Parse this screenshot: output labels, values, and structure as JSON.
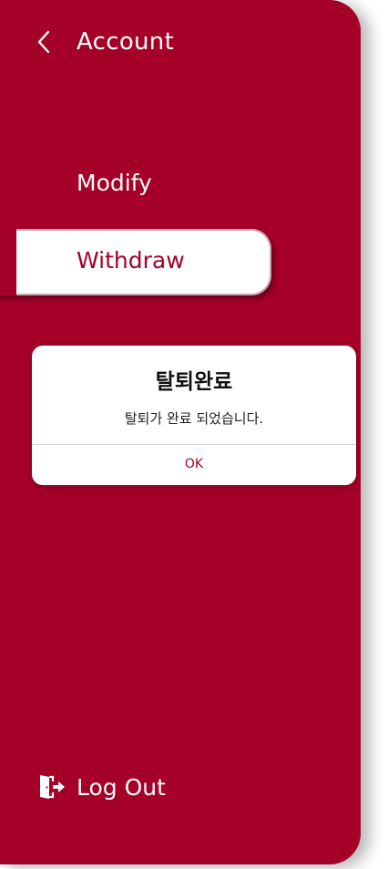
{
  "header": {
    "title": "Account",
    "back_icon": "chevron-left-icon"
  },
  "menu": {
    "items": [
      {
        "label": "Modify",
        "active": false
      },
      {
        "label": "Withdraw",
        "active": true
      }
    ]
  },
  "dialog": {
    "title": "탈퇴완료",
    "message": "탈퇴가 완료 되었습니다.",
    "ok_label": "OK"
  },
  "footer": {
    "logout_label": "Log Out",
    "logout_icon": "logout-door-icon"
  },
  "colors": {
    "brand": "#a50028",
    "surface": "#ffffff"
  }
}
